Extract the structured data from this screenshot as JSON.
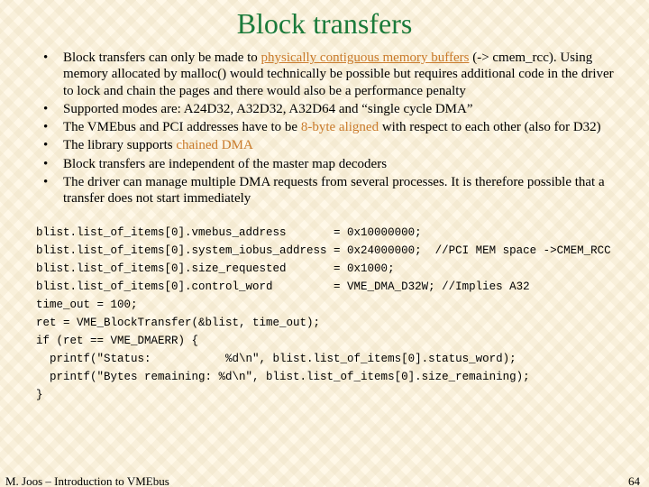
{
  "title": "Block transfers",
  "bullets": [
    {
      "pre": "Block transfers can only be made to ",
      "emph": "physically contiguous memory buffers",
      "emph_underline": true,
      "post": " (-> cmem_rcc). Using memory allocated by malloc() would technically be possible but requires additional code in the driver to lock and chain the pages and there would also be a performance penalty"
    },
    {
      "pre": "Supported modes are: A24D32, A32D32, A32D64 and “single cycle DMA”",
      "emph": "",
      "emph_underline": false,
      "post": ""
    },
    {
      "pre": "The VMEbus and PCI addresses have to be ",
      "emph": "8-byte aligned",
      "emph_underline": false,
      "post": " with respect to each other (also for D32)"
    },
    {
      "pre": "The library supports ",
      "emph": "chained DMA",
      "emph_underline": false,
      "post": ""
    },
    {
      "pre": "Block transfers are independent of the master map decoders",
      "emph": "",
      "emph_underline": false,
      "post": ""
    },
    {
      "pre": "The driver can manage multiple DMA requests from several processes. It is therefore possible that a transfer does not start immediately",
      "emph": "",
      "emph_underline": false,
      "post": ""
    }
  ],
  "code_lines": [
    "blist.list_of_items[0].vmebus_address       = 0x10000000;",
    "blist.list_of_items[0].system_iobus_address = 0x24000000;  //PCI MEM space ->CMEM_RCC",
    "blist.list_of_items[0].size_requested       = 0x1000;",
    "blist.list_of_items[0].control_word         = VME_DMA_D32W; //Implies A32",
    "time_out = 100;",
    "ret = VME_BlockTransfer(&blist, time_out);",
    "if (ret == VME_DMAERR) {",
    "  printf(\"Status:           %d\\n\", blist.list_of_items[0].status_word);",
    "  printf(\"Bytes remaining: %d\\n\", blist.list_of_items[0].size_remaining);",
    "}"
  ],
  "footer": "M. Joos – Introduction to VMEbus",
  "page_number": "64"
}
